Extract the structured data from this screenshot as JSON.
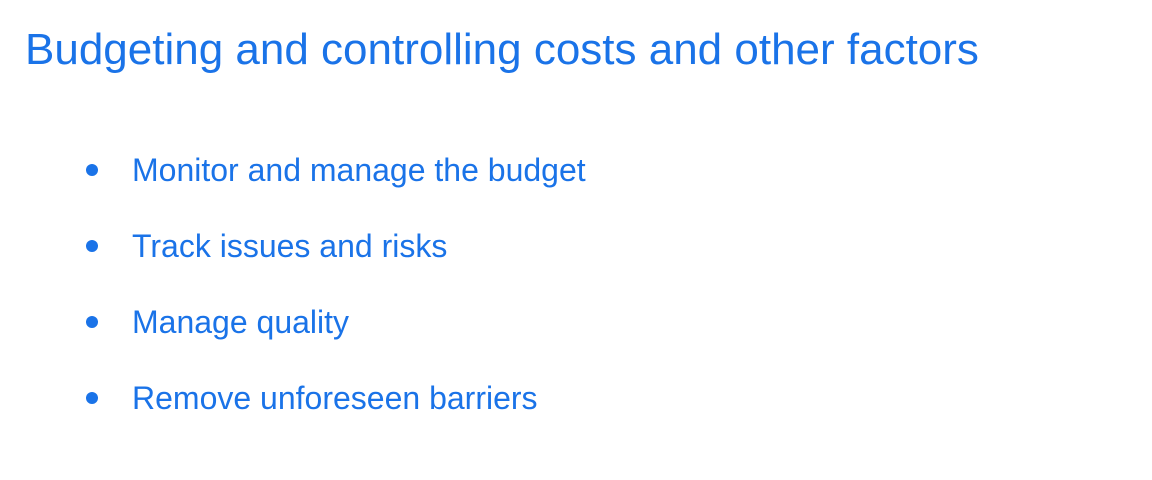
{
  "slide": {
    "title": "Budgeting and controlling costs and other factors",
    "bullets": [
      "Monitor and manage the budget",
      "Track issues and risks",
      "Manage quality",
      "Remove unforeseen barriers"
    ],
    "accent_color": "#1a73e8",
    "background_color": "#ffffff"
  }
}
